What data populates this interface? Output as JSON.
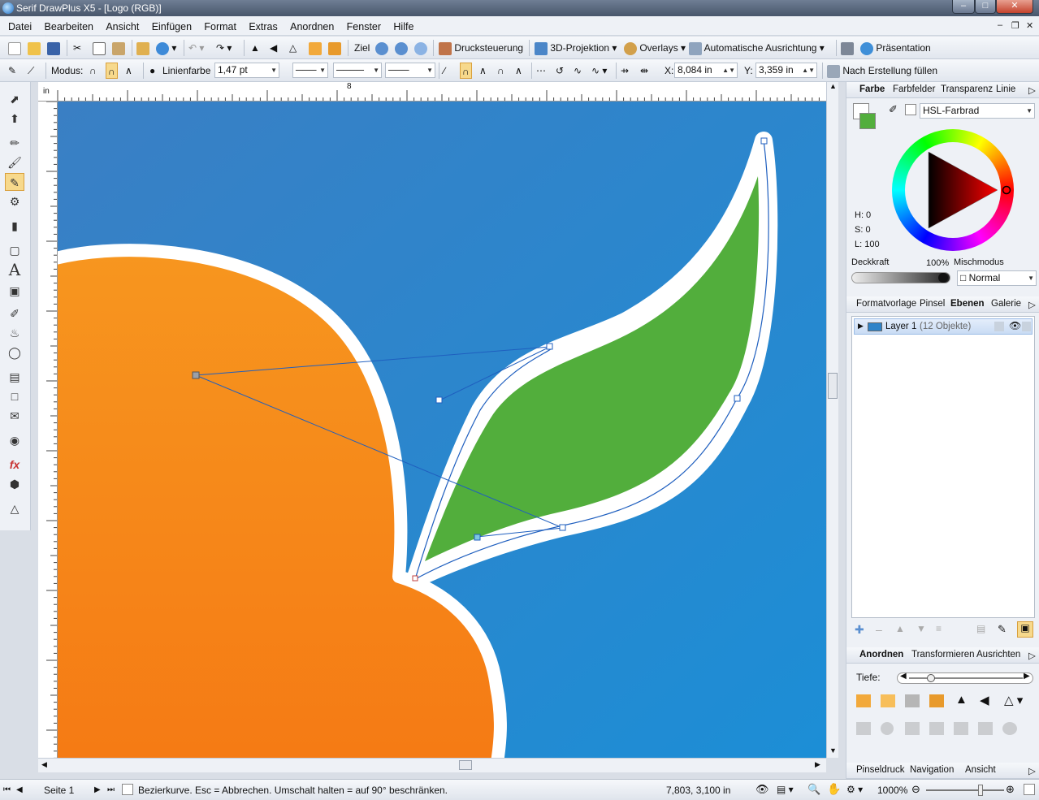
{
  "window": {
    "title": "Serif DrawPlus X5 - [Logo (RGB)]"
  },
  "menu": {
    "items": [
      "Datei",
      "Bearbeiten",
      "Ansicht",
      "Einfügen",
      "Format",
      "Extras",
      "Anordnen",
      "Fenster",
      "Hilfe"
    ]
  },
  "toolbar1": {
    "ziel_label": "Ziel",
    "druck_label": "Drucksteuerung",
    "projektion_label": "3D-Projektion",
    "overlays_label": "Overlays",
    "ausrichtung_label": "Automatische Ausrichtung",
    "praesentation_label": "Präsentation"
  },
  "toolbar2": {
    "modus_label": "Modus:",
    "linienfarbe_label": "Linienfarbe",
    "linienbreite_value": "1,47 pt",
    "x_label": "X:",
    "x_value": "8,084 in",
    "y_label": "Y:",
    "y_value": "3,359 in",
    "fill_label": "Nach Erstellung füllen"
  },
  "ruler": {
    "unit": "in",
    "mark_label": "8"
  },
  "colorpanel": {
    "tabs": [
      "Farbe",
      "Farbfelder",
      "Transparenz",
      "Linie"
    ],
    "mode_value": "HSL-Farbrad",
    "h_label": "H: 0",
    "s_label": "S: 0",
    "l_label": "L: 100",
    "deckkraft_label": "Deckkraft",
    "deckkraft_value": "100%",
    "mischmodus_label": "Mischmodus",
    "mischmodus_value": "Normal"
  },
  "layerpanel": {
    "tabs": [
      "Formatvorlage",
      "Pinsel",
      "Ebenen",
      "Galerie"
    ],
    "layer_name": "Layer 1",
    "layer_count": "(12 Objekte)"
  },
  "arrangepanel": {
    "tabs": [
      "Anordnen",
      "Transformieren",
      "Ausrichten"
    ],
    "tiefe_label": "Tiefe:"
  },
  "bottompanel": {
    "tabs": [
      "Pinseldruck",
      "Navigation",
      "Ansicht"
    ]
  },
  "status": {
    "page_label": "Seite 1",
    "hint": "Bezierkurve. Esc = Abbrechen. Umschalt halten = auf 90° beschränken.",
    "coords": "7,803,  3,100 in",
    "zoom": "1000%"
  },
  "colors": {
    "canvas_blue": "#2f84c9",
    "orange": "#f7931e",
    "leaf_green": "#52ae3c",
    "outline_white": "#ffffff",
    "path_blue": "#1f5fbf"
  }
}
